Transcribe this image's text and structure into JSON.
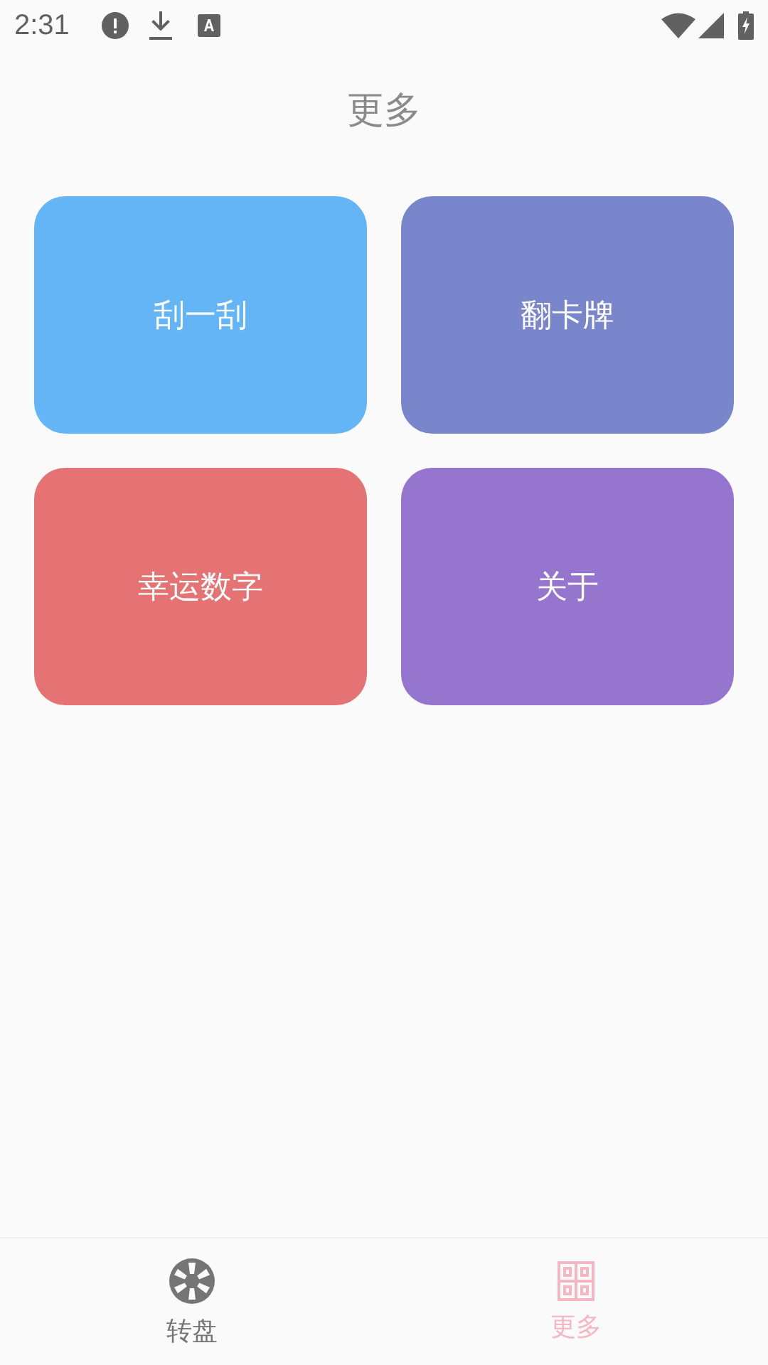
{
  "status_bar": {
    "time": "2:31"
  },
  "title": "更多",
  "tiles": [
    {
      "label": "刮一刮",
      "color": "#64b5f6"
    },
    {
      "label": "翻卡牌",
      "color": "#7986cb"
    },
    {
      "label": "幸运数字",
      "color": "#e57373"
    },
    {
      "label": "关于",
      "color": "#9575cd"
    }
  ],
  "bottom_nav": [
    {
      "label": "转盘",
      "kind": "wheel",
      "selected": false
    },
    {
      "label": "更多",
      "kind": "grid",
      "selected": true
    }
  ]
}
